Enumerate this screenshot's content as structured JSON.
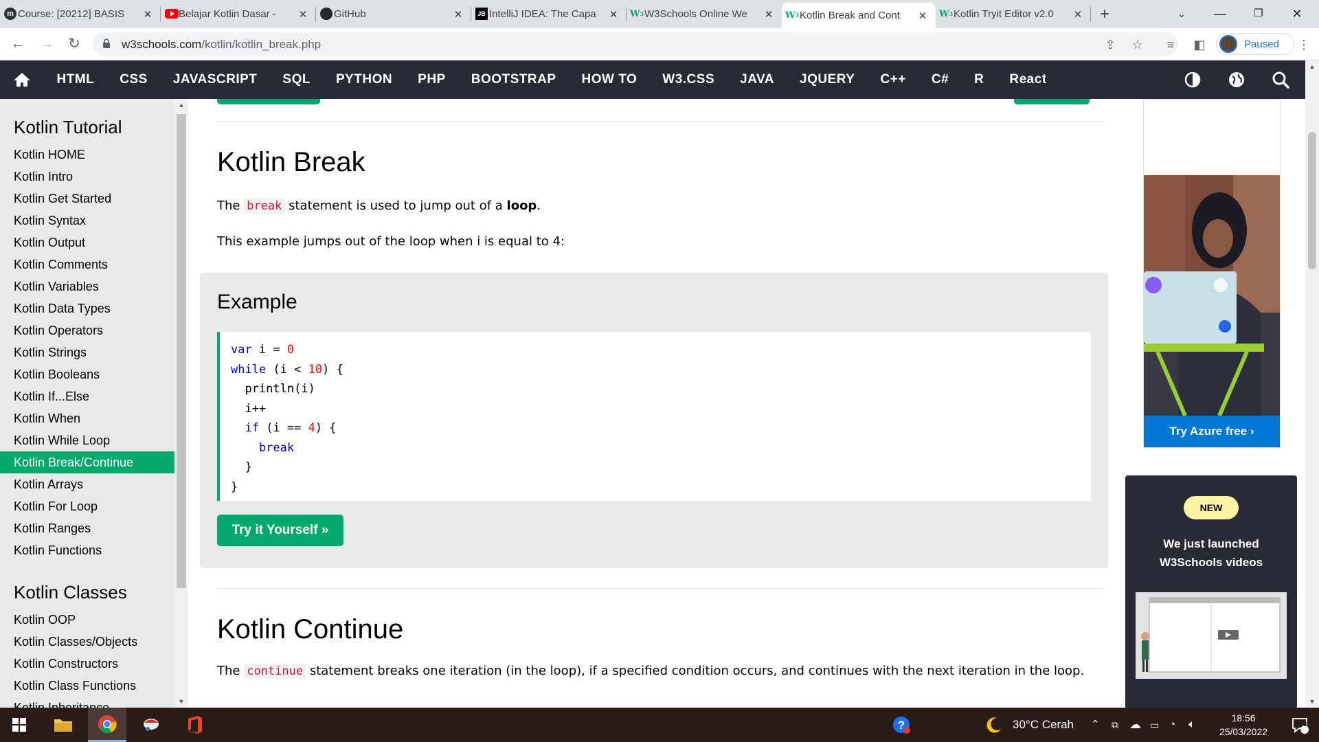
{
  "browser": {
    "tabs": [
      {
        "title": "Course: [20212] BASIS",
        "icon": "moodle-icon"
      },
      {
        "title": "Belajar Kotlin Dasar -",
        "icon": "youtube-icon"
      },
      {
        "title": "GitHub",
        "icon": "github-icon"
      },
      {
        "title": "IntelliJ IDEA: The Capa",
        "icon": "jetbrains-icon"
      },
      {
        "title": "W3Schools Online We",
        "icon": "w3schools-icon"
      },
      {
        "title": "Kotlin Break and Cont",
        "icon": "w3schools-icon",
        "active": true
      },
      {
        "title": "Kotlin Tryit Editor v2.0",
        "icon": "w3schools-icon"
      }
    ],
    "url_host": "w3schools.com",
    "url_path": "/kotlin/kotlin_break.php",
    "profile_status": "Paused"
  },
  "nav": {
    "items": [
      "HTML",
      "CSS",
      "JAVASCRIPT",
      "SQL",
      "PYTHON",
      "PHP",
      "BOOTSTRAP",
      "HOW TO",
      "W3.CSS",
      "JAVA",
      "JQUERY",
      "C++",
      "C#",
      "R",
      "React"
    ]
  },
  "sidebar": {
    "heading1": "Kotlin Tutorial",
    "tutorial_items": [
      "Kotlin HOME",
      "Kotlin Intro",
      "Kotlin Get Started",
      "Kotlin Syntax",
      "Kotlin Output",
      "Kotlin Comments",
      "Kotlin Variables",
      "Kotlin Data Types",
      "Kotlin Operators",
      "Kotlin Strings",
      "Kotlin Booleans",
      "Kotlin If...Else",
      "Kotlin When",
      "Kotlin While Loop",
      "Kotlin Break/Continue",
      "Kotlin Arrays",
      "Kotlin For Loop",
      "Kotlin Ranges",
      "Kotlin Functions"
    ],
    "active_item": "Kotlin Break/Continue",
    "heading2": "Kotlin Classes",
    "class_items": [
      "Kotlin OOP",
      "Kotlin Classes/Objects",
      "Kotlin Constructors",
      "Kotlin Class Functions",
      "Kotlin Inheritance"
    ]
  },
  "main": {
    "title": "Kotlin Break",
    "p1_before": "The ",
    "p1_code": "break",
    "p1_mid": " statement is used to jump out of a ",
    "p1_bold": "loop",
    "p1_after": ".",
    "p2": "This example jumps out of the loop when i is equal to 4:",
    "example_heading": "Example",
    "try_button": "Try it Yourself »",
    "title2": "Kotlin Continue",
    "p3_before": "The ",
    "p3_code": "continue",
    "p3_after": " statement breaks one iteration (in the loop), if a specified condition occurs, and continues with the next iteration in the loop."
  },
  "ad": {
    "button": "Try Azure free ›"
  },
  "promo": {
    "badge": "NEW",
    "line1": "We just launched",
    "line2": "W3Schools videos"
  },
  "taskbar": {
    "weather": "30°C  Cerah",
    "time": "18:56",
    "date": "25/03/2022",
    "notifications": "3"
  },
  "colors": {
    "w3_green": "#04aa6d",
    "nav_dark": "#282a35",
    "sidebar_bg": "#e7e9eb",
    "code_red": "#dc143c"
  }
}
